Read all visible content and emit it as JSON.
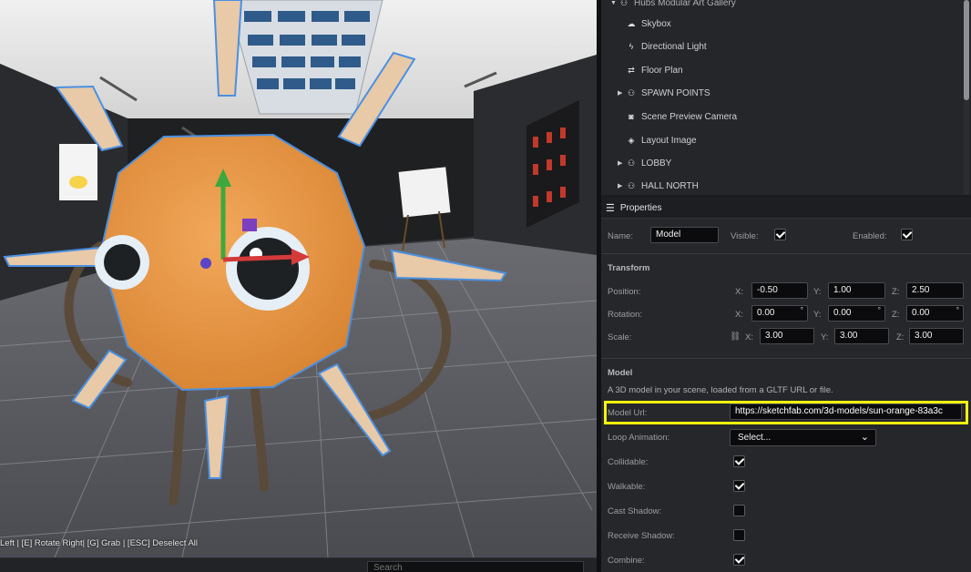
{
  "viewport": {
    "hint_text": "Left | [E] Rotate Right| [G] Grab | [ESC] Deselect All",
    "search_placeholder": "Search"
  },
  "hierarchy": {
    "items": [
      {
        "label": "Hubs Modular Art Gallery",
        "icon": "expand-arrow",
        "expandable": true
      },
      {
        "label": "Skybox",
        "icon": "cloud-icon"
      },
      {
        "label": "Directional Light",
        "icon": "bolt-icon"
      },
      {
        "label": "Floor Plan",
        "icon": "route-icon"
      },
      {
        "label": "SPAWN POINTS",
        "icon": "group-icon",
        "expandable": true
      },
      {
        "label": "Scene Preview Camera",
        "icon": "camera-icon"
      },
      {
        "label": "Layout Image",
        "icon": "cube-icon"
      },
      {
        "label": "LOBBY",
        "icon": "group-icon",
        "expandable": true
      },
      {
        "label": "HALL NORTH",
        "icon": "group-icon",
        "expandable": true
      }
    ]
  },
  "properties": {
    "title": "Properties",
    "name_label": "Name:",
    "name_value": "Model",
    "visible_label": "Visible:",
    "visible": true,
    "enabled_label": "Enabled:",
    "enabled": true,
    "transform": {
      "title": "Transform",
      "position_label": "Position:",
      "rotation_label": "Rotation:",
      "scale_label": "Scale:",
      "axes": [
        "X:",
        "Y:",
        "Z:"
      ],
      "position": [
        "-0.50",
        "1.00",
        "2.50"
      ],
      "rotation": [
        "0.00",
        "0.00",
        "0.00"
      ],
      "scale": [
        "3.00",
        "3.00",
        "3.00"
      ],
      "degree_symbol": "°"
    },
    "model": {
      "title": "Model",
      "description": "A 3D model in your scene, loaded from a GLTF URL or file.",
      "url_label": "Model Url:",
      "url_value": "https://sketchfab.com/3d-models/sun-orange-83a3c",
      "loop_label": "Loop Animation:",
      "loop_value": "Select...",
      "collidable_label": "Collidable:",
      "collidable": true,
      "walkable_label": "Walkable:",
      "walkable": true,
      "cast_shadow_label": "Cast Shadow:",
      "cast_shadow": false,
      "receive_shadow_label": "Receive Shadow:",
      "receive_shadow": false,
      "combine_label": "Combine:",
      "combine": true
    }
  },
  "colors": {
    "highlight": "#f4f40e",
    "character_body": "#e89a4a",
    "selection_outline": "#4a90e2"
  }
}
